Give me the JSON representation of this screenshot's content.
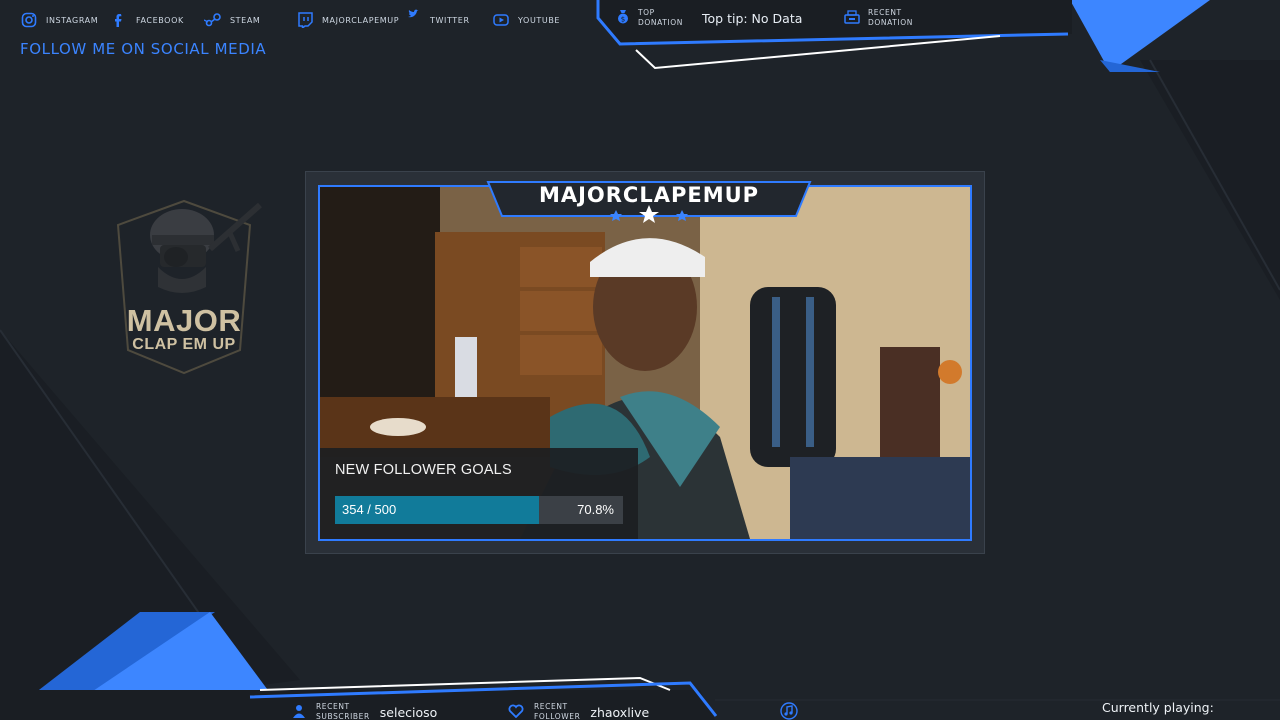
{
  "social": {
    "items": [
      {
        "icon": "instagram-icon",
        "label": "Instagram"
      },
      {
        "icon": "facebook-icon",
        "label": "Facebook"
      },
      {
        "icon": "steam-icon",
        "label": "Steam"
      },
      {
        "icon": "twitch-icon",
        "label": "Majorclapemup"
      },
      {
        "icon": "twitter-icon",
        "label": "Twitter"
      },
      {
        "icon": "youtube-icon",
        "label": "Youtube"
      }
    ],
    "follow_title": "FOLLOW ME ON SOCIAL MEDIA"
  },
  "donations": {
    "top_label_line1": "Top",
    "top_label_line2": "Donation",
    "top_tip": "Top tip: No Data",
    "recent_label_line1": "Recent",
    "recent_label_line2": "Donation"
  },
  "logo": {
    "line1": "MAJOR",
    "line2": "CLAP EM UP"
  },
  "stream": {
    "channel_name": "MAJORCLAPEMUP"
  },
  "follower_goal": {
    "title": "NEW FOLLOWER GOALS",
    "count_text": "354 / 500",
    "percent_text": "70.8%",
    "progress": 0.708
  },
  "bottom": {
    "sub_label_line1": "Recent",
    "sub_label_line2": "Subscriber",
    "sub_value": "selecioso",
    "fol_label_line1": "Recent",
    "fol_label_line2": "Follower",
    "fol_value": "zhaoxlive",
    "now_playing": "Currently playing:"
  },
  "colors": {
    "accent": "#2f7bff",
    "background": "#1e2329",
    "goal_fill": "#117b9a"
  }
}
